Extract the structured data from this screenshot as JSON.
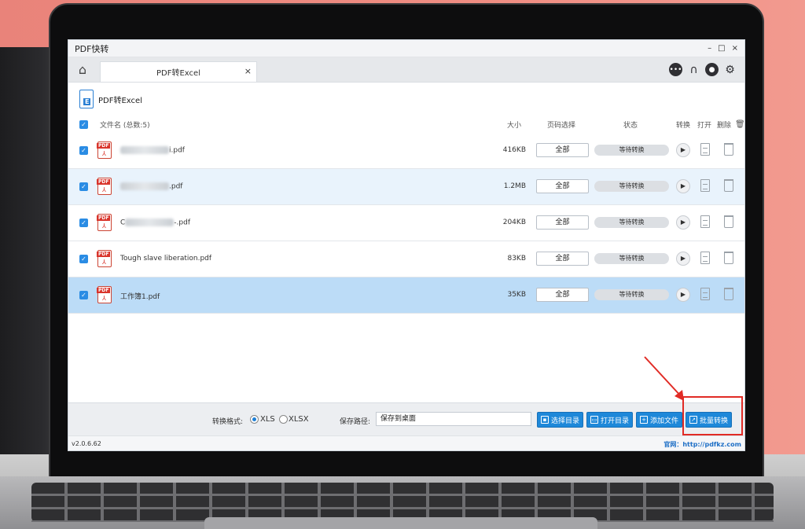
{
  "app": {
    "title": "PDF快转",
    "version": "v2.0.6.62",
    "website": "官网：http://pdfkz.com",
    "window_controls": [
      "–",
      "□",
      "×"
    ]
  },
  "tabs": [
    {
      "label": "PDF转Excel",
      "close": "×"
    }
  ],
  "header": {
    "title": "PDF转Excel"
  },
  "columns": {
    "filename": "文件名 (总数:5)",
    "size": "大小",
    "page_select": "页码选择",
    "status": "状态",
    "convert": "转换",
    "open": "打开",
    "delete": "删除"
  },
  "files": [
    {
      "name_suffix": "i.pdf",
      "name_prefix": "",
      "size": "416KB",
      "pages": "全部",
      "status": "等待转换",
      "blurred": true
    },
    {
      "name_suffix": ".pdf",
      "name_prefix": "",
      "size": "1.2MB",
      "pages": "全部",
      "status": "等待转换",
      "blurred": true
    },
    {
      "name_suffix": "-.pdf",
      "name_prefix": "C",
      "size": "204KB",
      "pages": "全部",
      "status": "等待转换",
      "blurred": true
    },
    {
      "name_suffix": "",
      "name_prefix": "Tough slave liberation.pdf",
      "size": "83KB",
      "pages": "全部",
      "status": "等待转换",
      "blurred": false
    },
    {
      "name_suffix": "",
      "name_prefix": "工作簿1.pdf",
      "size": "35KB",
      "pages": "全部",
      "status": "等待转换",
      "blurred": false
    }
  ],
  "bottom": {
    "format_label": "转换格式:",
    "format_options": [
      "XLS",
      "XLSX"
    ],
    "format_selected": "XLS",
    "save_path_label": "保存路径:",
    "save_path_value": "保存到桌面",
    "buttons": {
      "choose_dir": "选择目录",
      "open_dir": "打开目录",
      "add_file": "添加文件",
      "batch_convert": "批量转换"
    }
  },
  "colors": {
    "accent": "#1e88d9",
    "highlight": "#e12b25",
    "selected_row": "#bcdcf7"
  }
}
